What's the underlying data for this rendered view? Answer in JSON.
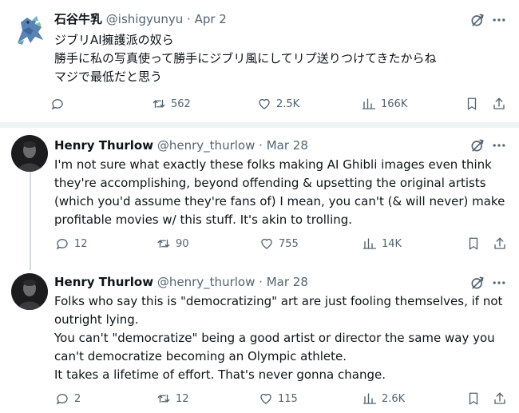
{
  "tweets": [
    {
      "name": "石谷牛乳",
      "handle": "@ishigyunyu",
      "separator": "·",
      "date": "Apr 2",
      "lines": [
        "ジブリAI擁護派の奴ら",
        "勝手に私の写真使って勝手にジブリ風にしてリプ送りつけてきたからね",
        "マジで最低だと思う"
      ],
      "replies": "",
      "retweets": "562",
      "likes": "2.5K",
      "views": "166K"
    },
    {
      "name": "Henry Thurlow",
      "handle": "@henry_thurlow",
      "separator": "·",
      "date": "Mar 28",
      "lines": [
        "I'm not sure what exactly these folks making AI Ghibli images even think",
        "they're accomplishing, beyond offending & upsetting the original artists",
        "(which you'd assume they're fans of) I mean, you can't (& will never) make",
        "profitable movies w/ this stuff. It's akin to trolling."
      ],
      "replies": "12",
      "retweets": "90",
      "likes": "755",
      "views": "14K"
    },
    {
      "name": "Henry Thurlow",
      "handle": "@henry_thurlow",
      "separator": "·",
      "date": "Mar 28",
      "lines": [
        "Folks who say this is \"democratizing\" art are just fooling themselves, if not",
        "outright lying.",
        "You can't \"democratize\" being a good artist or director the same way you",
        "can't democratize becoming an Olympic athlete.",
        "It takes a lifetime of effort. That's never gonna change."
      ],
      "replies": "2",
      "retweets": "12",
      "likes": "115",
      "views": "2.6K"
    }
  ],
  "colors": {
    "text": "#0f1419",
    "muted": "#536471",
    "divider": "#eff3f4",
    "thread_line": "#cfd9de"
  }
}
